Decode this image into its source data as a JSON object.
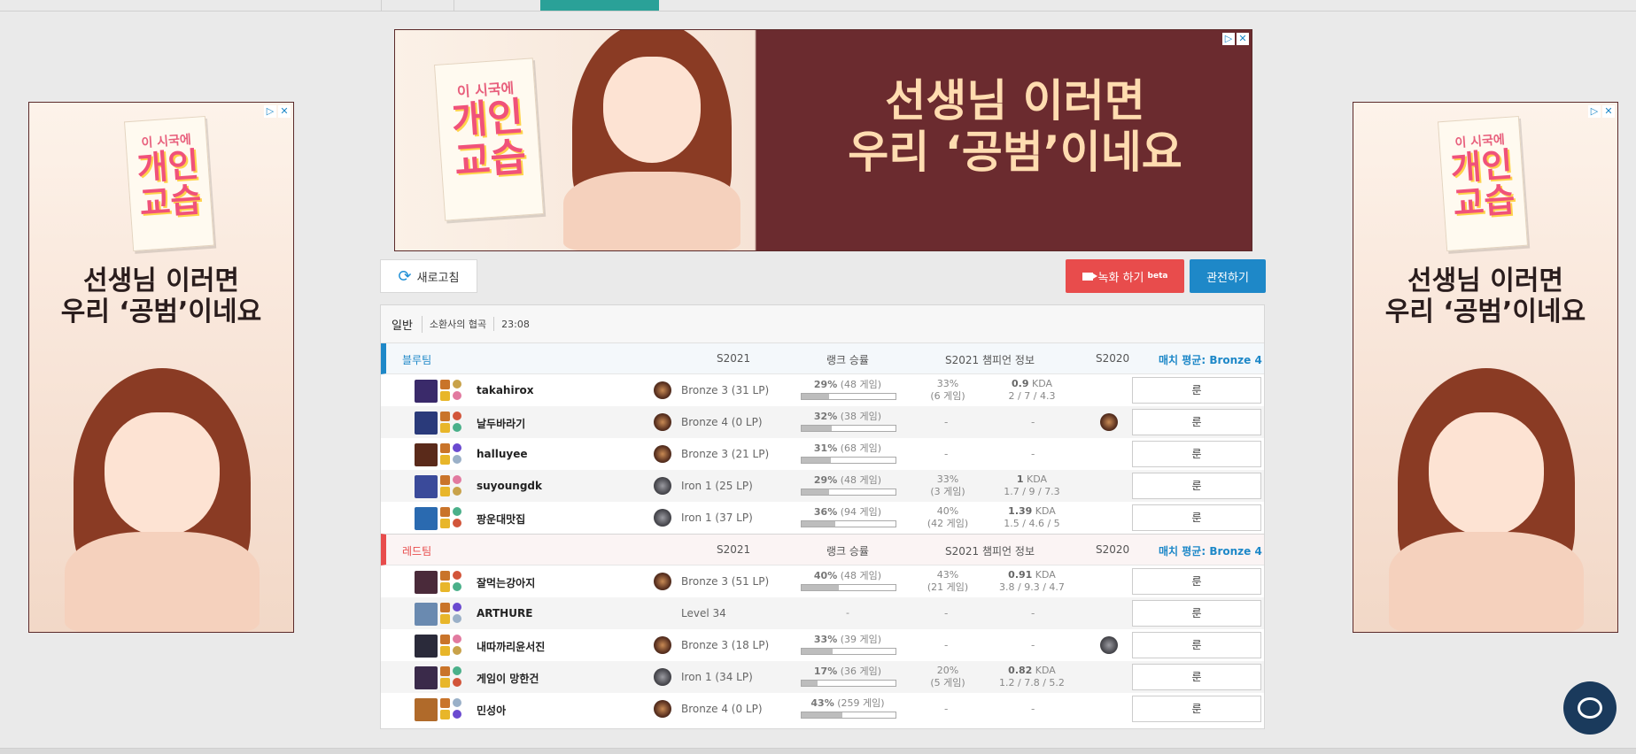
{
  "ads": {
    "headline1": "선생님 이러면",
    "headline2": "우리 ‘공범’이네요",
    "notepad_small": "이 시국에",
    "notepad_big1": "개인",
    "notepad_big2": "교습"
  },
  "actions": {
    "refresh": "새로고침",
    "record": "녹화 하기",
    "record_beta": "beta",
    "spectate": "관전하기"
  },
  "match": {
    "mode": "일반",
    "map": "소환사의 협곡",
    "time": "23:08"
  },
  "columns": {
    "season": "S2021",
    "rank_winrate": "랭크 승률",
    "champ_info": "S2021 챔피언 정보",
    "prev_season": "S2020"
  },
  "teams": [
    {
      "name": "블루팀",
      "avg": "매치 평균: Bronze 4",
      "players": [
        {
          "name": "takahirox",
          "tier": "Bronze 3 (31 LP)",
          "tier_type": "bronze",
          "wr_pct": "29%",
          "wr_games": "(48 게임)",
          "wr_value": 29,
          "cw_pct": "33%",
          "cw_games": "(6 게임)",
          "kda": "0.9",
          "kda_detail": "2 / 7 / 4.3",
          "s2020": "",
          "portrait": "#3a2a6a",
          "rune_label": "룬"
        },
        {
          "name": "날두바라기",
          "tier": "Bronze 4 (0 LP)",
          "tier_type": "bronze",
          "wr_pct": "32%",
          "wr_games": "(38 게임)",
          "wr_value": 32,
          "cw_pct": "",
          "cw_games": "",
          "kda": "",
          "kda_detail": "",
          "s2020": "bronze",
          "portrait": "#2a3a7a",
          "rune_label": "룬"
        },
        {
          "name": "halluyee",
          "tier": "Bronze 3 (21 LP)",
          "tier_type": "bronze",
          "wr_pct": "31%",
          "wr_games": "(68 게임)",
          "wr_value": 31,
          "cw_pct": "",
          "cw_games": "",
          "kda": "",
          "kda_detail": "",
          "s2020": "",
          "portrait": "#5a2a1a",
          "rune_label": "룬"
        },
        {
          "name": "suyoungdk",
          "tier": "Iron 1 (25 LP)",
          "tier_type": "iron",
          "wr_pct": "29%",
          "wr_games": "(48 게임)",
          "wr_value": 29,
          "cw_pct": "33%",
          "cw_games": "(3 게임)",
          "kda": "1",
          "kda_detail": "1.7 / 9 / 7.3",
          "s2020": "",
          "portrait": "#3a4a9a",
          "rune_label": "룬"
        },
        {
          "name": "팡운대맛집",
          "tier": "Iron 1 (37 LP)",
          "tier_type": "iron",
          "wr_pct": "36%",
          "wr_games": "(94 게임)",
          "wr_value": 36,
          "cw_pct": "40%",
          "cw_games": "(42 게임)",
          "kda": "1.39",
          "kda_detail": "1.5 / 4.6 / 5",
          "s2020": "",
          "portrait": "#2a6ab0",
          "rune_label": "룬"
        }
      ]
    },
    {
      "name": "레드팀",
      "avg": "매치 평균: Bronze 4",
      "players": [
        {
          "name": "잘먹는강아지",
          "tier": "Bronze 3 (51 LP)",
          "tier_type": "bronze",
          "wr_pct": "40%",
          "wr_games": "(48 게임)",
          "wr_value": 40,
          "cw_pct": "43%",
          "cw_games": "(21 게임)",
          "kda": "0.91",
          "kda_detail": "3.8 / 9.3 / 4.7",
          "s2020": "",
          "portrait": "#4a2a3a",
          "rune_label": "룬"
        },
        {
          "name": "ARTHURE",
          "tier": "Level 34",
          "tier_type": "none",
          "wr_pct": "",
          "wr_games": "",
          "wr_value": 0,
          "cw_pct": "",
          "cw_games": "",
          "kda": "",
          "kda_detail": "",
          "s2020": "",
          "portrait": "#6a8ab0",
          "rune_label": "룬"
        },
        {
          "name": "내따까리윤서진",
          "tier": "Bronze 3 (18 LP)",
          "tier_type": "bronze",
          "wr_pct": "33%",
          "wr_games": "(39 게임)",
          "wr_value": 33,
          "cw_pct": "",
          "cw_games": "",
          "kda": "",
          "kda_detail": "",
          "s2020": "iron",
          "portrait": "#2a2a3a",
          "rune_label": "룬"
        },
        {
          "name": "게임이 망한건",
          "tier": "Iron 1 (34 LP)",
          "tier_type": "iron",
          "wr_pct": "17%",
          "wr_games": "(36 게임)",
          "wr_value": 17,
          "cw_pct": "20%",
          "cw_games": "(5 게임)",
          "kda": "0.82",
          "kda_detail": "1.2 / 7.8 / 5.2",
          "s2020": "",
          "portrait": "#3a2a4a",
          "rune_label": "룬"
        },
        {
          "name": "민성아",
          "tier": "Bronze 4 (0 LP)",
          "tier_type": "bronze",
          "wr_pct": "43%",
          "wr_games": "(259 게임)",
          "wr_value": 43,
          "cw_pct": "",
          "cw_games": "",
          "kda": "",
          "kda_detail": "",
          "s2020": "",
          "portrait": "#b06a2a",
          "rune_label": "룬"
        }
      ]
    }
  ],
  "colors": {
    "blue": "#1e88c8",
    "red": "#e84c4c",
    "accent_tab": "#2aa198"
  }
}
